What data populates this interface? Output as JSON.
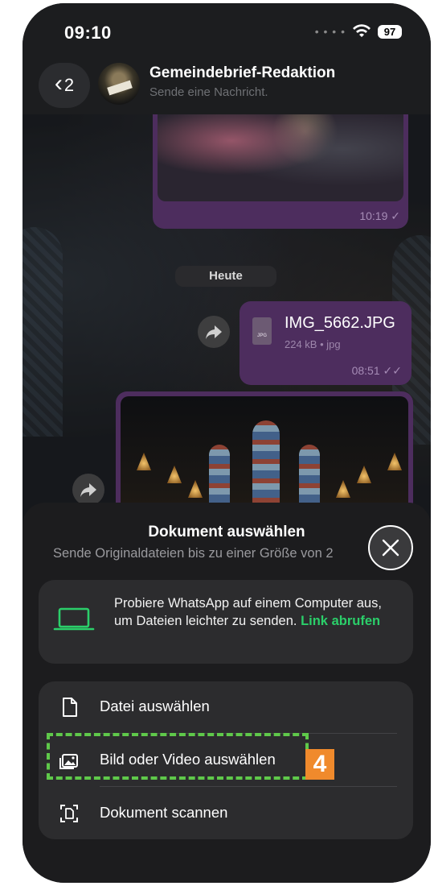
{
  "status_bar": {
    "time": "09:10",
    "battery": "97"
  },
  "header": {
    "back_count": "2",
    "chat_name": "Gemeindebrief-Redaktion",
    "subtitle": "Sende eine Nachricht."
  },
  "messages": {
    "photo_time": "10:19",
    "day_separator": "Heute",
    "file": {
      "name": "IMG_5662.JPG",
      "meta": "224 kB • jpg",
      "type_label": "JPG",
      "time": "08:51"
    }
  },
  "sheet": {
    "title": "Dokument auswählen",
    "subtitle": "Sende Originaldateien bis zu einer Größe von 2",
    "promo_text": "Probiere WhatsApp auf einem Computer aus, um Dateien leichter zu senden.",
    "promo_link": "Link abrufen",
    "options": [
      {
        "label": "Datei auswählen",
        "icon": "file-icon"
      },
      {
        "label": "Bild oder Video auswählen",
        "icon": "photo-icon"
      },
      {
        "label": "Dokument scannen",
        "icon": "scan-icon"
      }
    ]
  },
  "annotation": {
    "step": "4"
  },
  "colors": {
    "accent_green": "#2bcf6a",
    "bubble_purple": "#4d2d5e",
    "highlight_green": "#5fc94a",
    "badge_orange": "#f08a2c"
  }
}
